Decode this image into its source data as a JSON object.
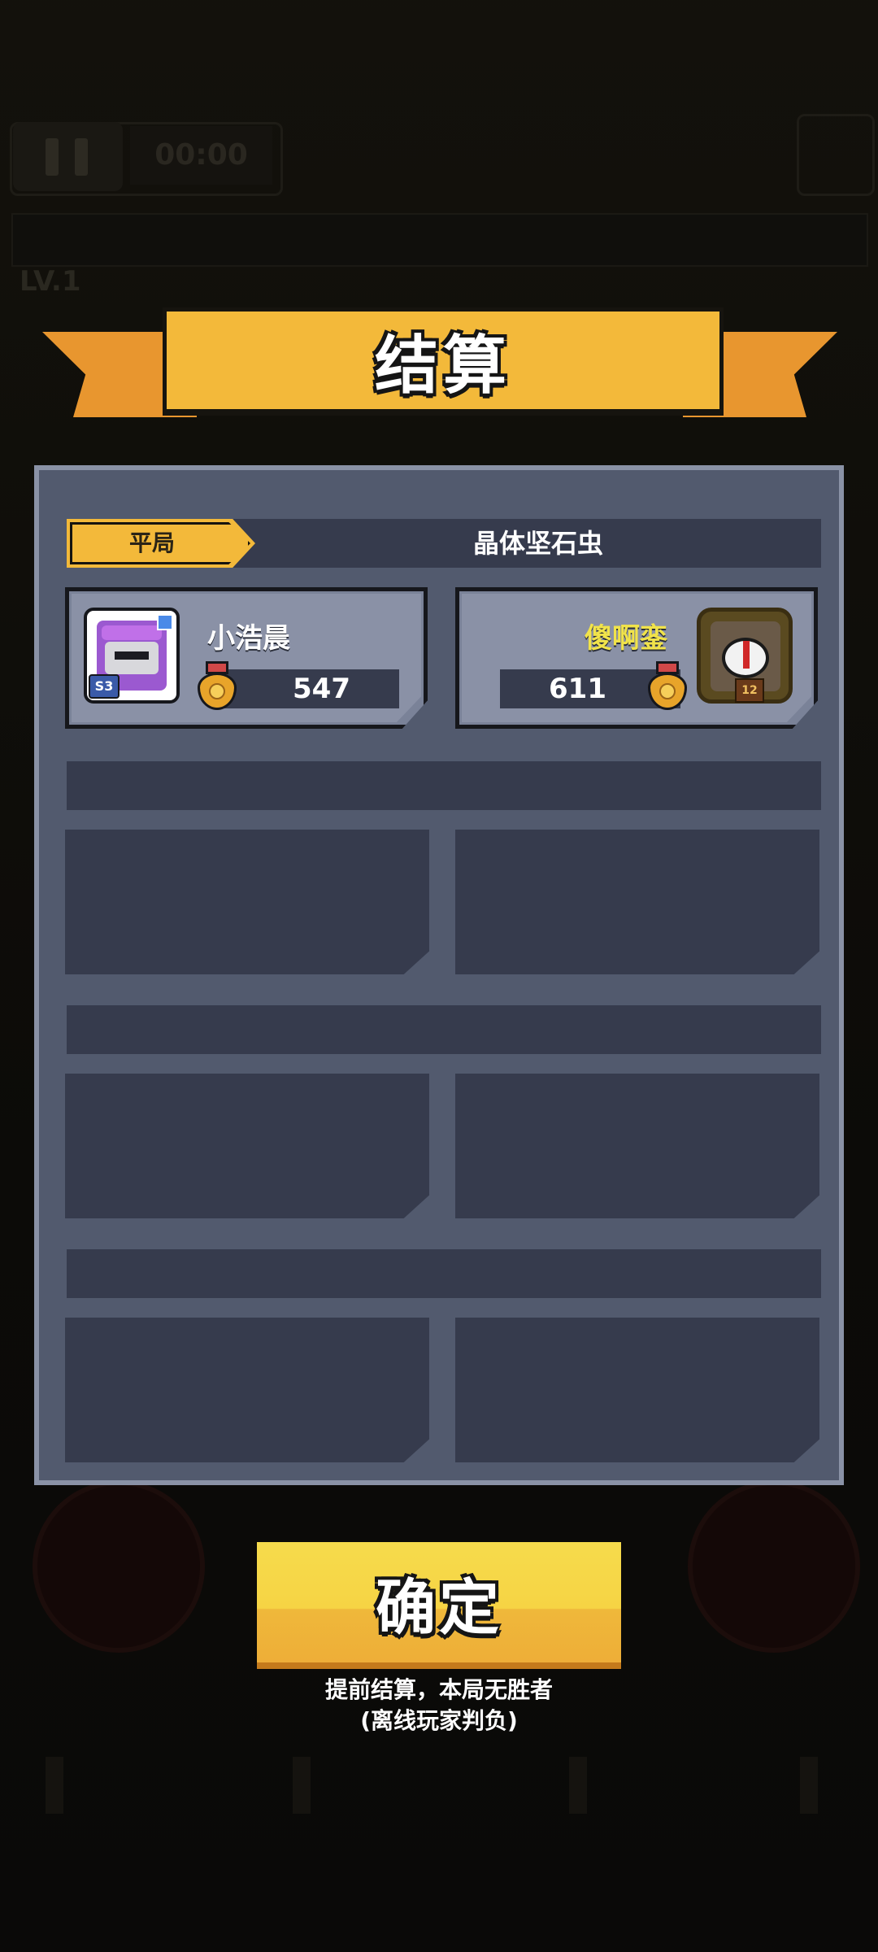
{
  "background": {
    "timer": "00:00",
    "level": "LV.1"
  },
  "banner": {
    "title": "结算"
  },
  "result": {
    "label": "平局",
    "map_name": "晶体坚石虫"
  },
  "players": [
    {
      "name": "小浩晨",
      "score": "547",
      "badge": "S3",
      "name_color": "#ffffff"
    },
    {
      "name": "傻啊銮",
      "score": "611",
      "badge": "12",
      "name_color": "#f1e34a"
    }
  ],
  "confirm": {
    "label": "确定"
  },
  "notes": {
    "line1": "提前结算，本局无胜者",
    "line2": "(离线玩家判负)"
  },
  "colors": {
    "accent_yellow": "#f3b93a",
    "accent_orange": "#e8962f",
    "panel": "#525a6e",
    "panel_dark": "#363b4d"
  }
}
